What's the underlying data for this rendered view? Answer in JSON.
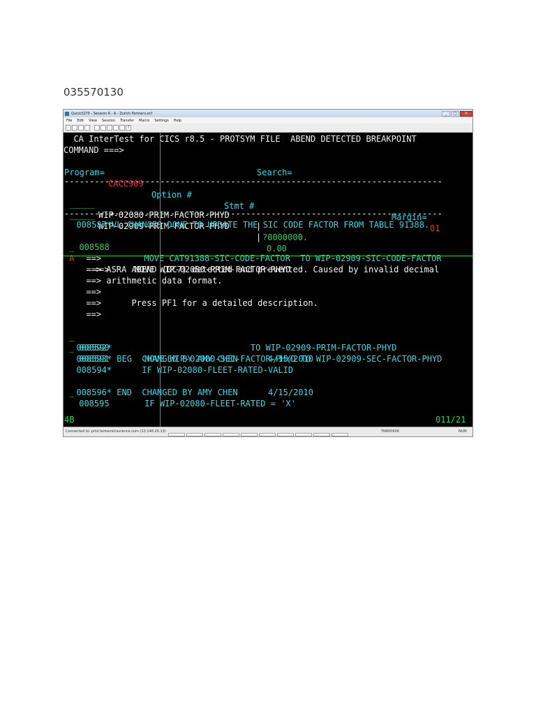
{
  "doc_id": "035570130",
  "window": {
    "title": "Quick3270 - Session A - A - Zurich Farmers.ecf",
    "menu": [
      "File",
      "Edit",
      "View",
      "Session",
      "Transfer",
      "Macro",
      "Settings",
      "Help"
    ]
  },
  "terminal": {
    "header_line": "  CA InterTest for CICS r8.5 - PROTSYM FILE  ABEND DETECTED BREAKPOINT",
    "command_label": "COMMAND ===>",
    "program_label": "Program=",
    "program_value": "CACC909",
    "option_label": "Option #",
    "stmt_label": "Stmt #",
    "margin_label": "Margin=",
    "margin_value": "01",
    "search_label": "Search=",
    "dashes": "---------------------------------------------------------------------------",
    "field1_name": "WIP-02080-PRIM-FACTOR-PHYD",
    "field1_value": "?0000000.",
    "field2_name": "WIP-02909-PRIM-FACTOR-PHYD",
    "field2_value": "0.00",
    "divider_line": "---------+-----------------------------------------------------------------",
    "code_line_1": "  008587*VL CHANGES DONE TO UPDATE THE SIC CODE FACTOR FROM TABLE 91388.",
    "code_line_2_prefix": "_ 008588",
    "code_line_2": "      MOVE CAT91388-SIC-CODE-FACTOR  TO WIP-02909-SIC-CODE-FACTOR",
    "code_line_3_prefix": "A",
    "code_line_3": "    ==>     MOVE WIP-02080-PRIM-FACTOR-PHYD",
    "msg_1": "  ==>",
    "msg_2": "  ==> ASRA ABEND (0C7) detected and prevented. Caused by invalid decimal",
    "msg_3": "  ==> arithmetic data format.",
    "msg_4": "  ==>",
    "msg_5": "  ==>      Press PF1 for a detailed description.",
    "msg_6": "  ==>",
    "code_line_4_prefix": "_",
    "code_line_4": " 008590                            TO WIP-02909-PRIM-FACTOR-PHYD",
    "code_line_5_prefix": "_",
    "code_line_5": " 008591       MOVE WIP-02080-SEC-FACTOR-PHYD TO WIP-02909-SEC-FACTOR-PHYD",
    "code_line_6": "  008592*",
    "code_line_7": "  008593* BEG  CHANGED BY AMY CHEN      4/15/2010",
    "code_line_8": "  008594*      IF WIP-02080-FLEET-RATED-VALID",
    "code_line_9_prefix": "_",
    "code_line_9": " 008595       IF WIP-02080-FLEET-RATED = 'X'",
    "code_line_10": "  008596* END  CHANGED BY AMY CHEN      4/15/2010",
    "oia_left": "4B",
    "oia_right": "011/21"
  },
  "status": {
    "connection": "Connected to: prtd.farmersinsurance.com (10.148.20.13)",
    "session": "TN800606",
    "mode": "NUM"
  },
  "colors": {
    "terminal_bg": "#000000",
    "cyan": "#2fd9e6",
    "green": "#23d45b",
    "red": "#f22a2a",
    "white": "#f2f2f2"
  }
}
